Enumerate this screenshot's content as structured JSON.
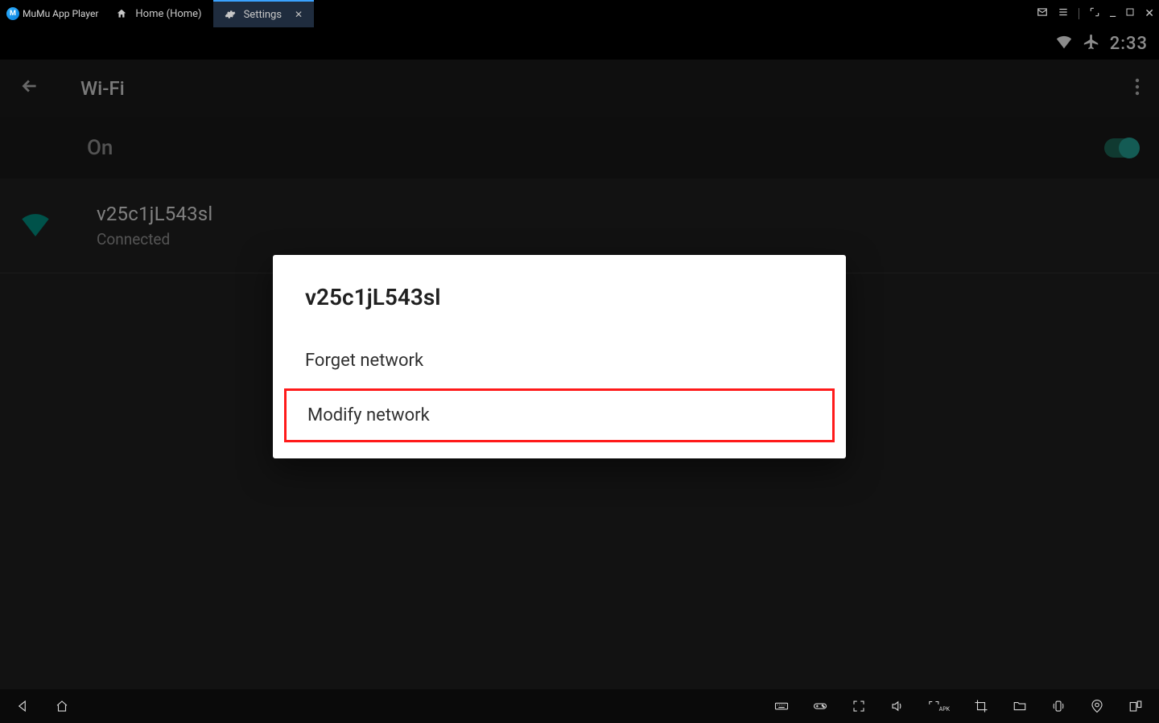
{
  "titlebar": {
    "app_name": "MuMu App Player",
    "tabs": [
      {
        "label": "Home (Home)"
      },
      {
        "label": "Settings"
      }
    ]
  },
  "status_bar": {
    "clock": "2:33"
  },
  "appbar": {
    "title": "Wi-Fi"
  },
  "wifi": {
    "toggle_label": "On",
    "network": {
      "ssid": "v25c1jL543sl",
      "status": "Connected"
    }
  },
  "dialog": {
    "title": "v25c1jL543sl",
    "forget": "Forget network",
    "modify": "Modify network"
  }
}
